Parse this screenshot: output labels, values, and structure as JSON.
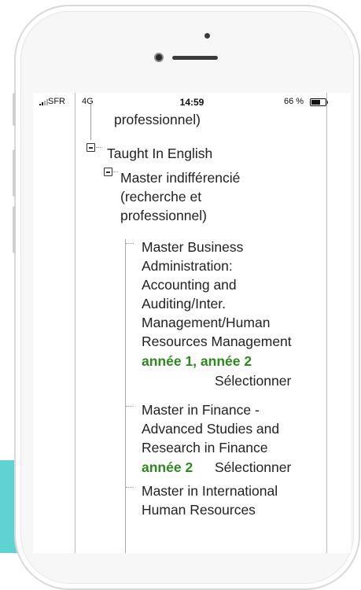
{
  "status_bar": {
    "carrier": "SFR",
    "network": "4G",
    "time": "14:59",
    "battery_percent": "66 %",
    "battery_level": 0.66
  },
  "tree": {
    "top_fragment": "professionnel)",
    "group": {
      "label": "Taught In English",
      "sub_group": {
        "label_lines": [
          "Master indifférencié",
          "(recherche et",
          "professionnel)"
        ],
        "programs": [
          {
            "title_lines": [
              "Master Business",
              "Administration:",
              "Accounting and",
              "Auditing/Inter.",
              "Management/Human",
              "Resources Management"
            ],
            "years": "année 1, année 2",
            "action": "Sélectionner"
          },
          {
            "title_lines": [
              "Master in Finance -",
              "Advanced Studies and",
              "Research in Finance"
            ],
            "years": "année 2",
            "action": "Sélectionner"
          },
          {
            "title_lines": [
              "Master in International",
              "Human Resources"
            ]
          }
        ]
      }
    }
  }
}
